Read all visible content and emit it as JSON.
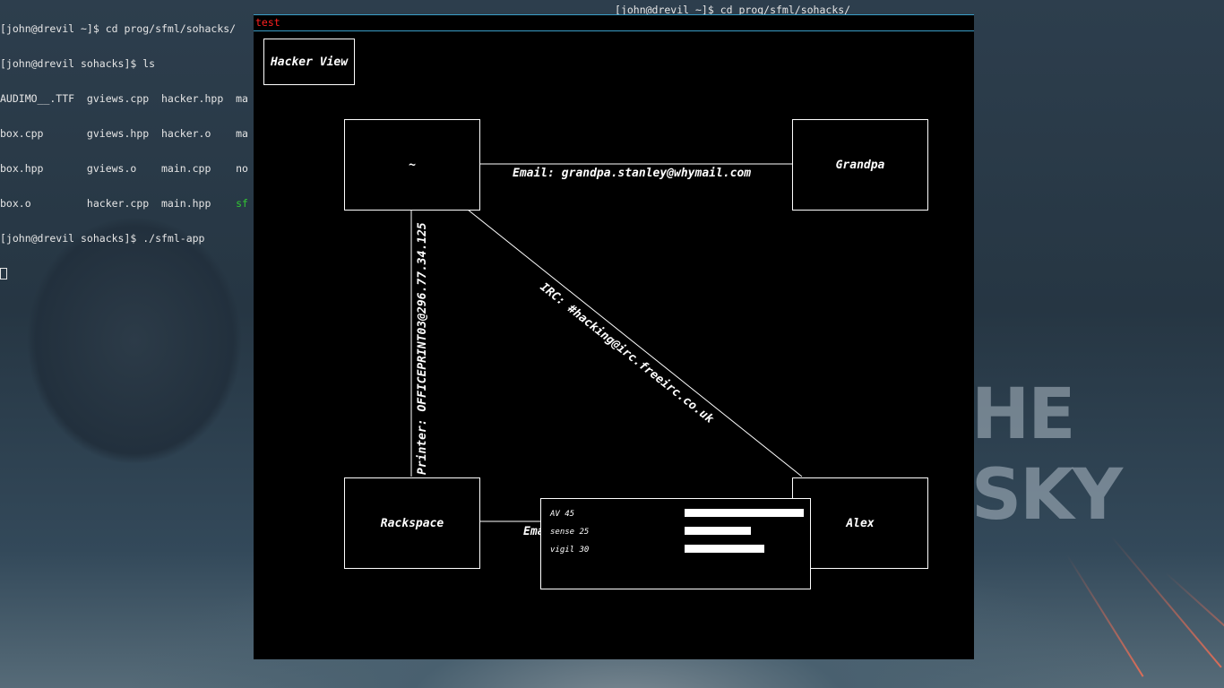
{
  "desktop": {
    "wallpaper_text": "HE SKY"
  },
  "terminal": {
    "lines": [
      "[john@drevil ~]$ cd prog/sfml/sohacks/",
      "[john@drevil sohacks]$ ls",
      "AUDIMO__.TTF  gviews.cpp  hacker.hpp  ma",
      "box.cpp       gviews.hpp  hacker.o    ma",
      "box.hpp       gviews.o    main.cpp    no",
      "box.o         hacker.cpp  main.hpp    ",
      "[john@drevil sohacks]$ ./sfml-app"
    ],
    "green_fragment": "sf",
    "top_line": "[john@drevil ~]$ cd prog/sfml/sohacks/"
  },
  "window": {
    "title": "test",
    "title_color": "#ff2020",
    "border_color": "#3a9ec8"
  },
  "app": {
    "hacker_view_button": "Hacker View",
    "nodes": {
      "home": "~",
      "grandpa": "Grandpa",
      "rackspace": "Rackspace",
      "alex": "Alex"
    },
    "edges": {
      "home_grandpa": "Email: grandpa.stanley@whymail.com",
      "home_alex": "IRC: #hacking@irc.freeirc.co.uk",
      "home_rackspace": "Printer: OFFICEPRINT03@296.77.34.125",
      "rackspace_alex": "Ema"
    },
    "stats": [
      {
        "label": "AV 45",
        "value": 45
      },
      {
        "label": "sense 25",
        "value": 25
      },
      {
        "label": "vigil 30",
        "value": 30
      }
    ]
  }
}
